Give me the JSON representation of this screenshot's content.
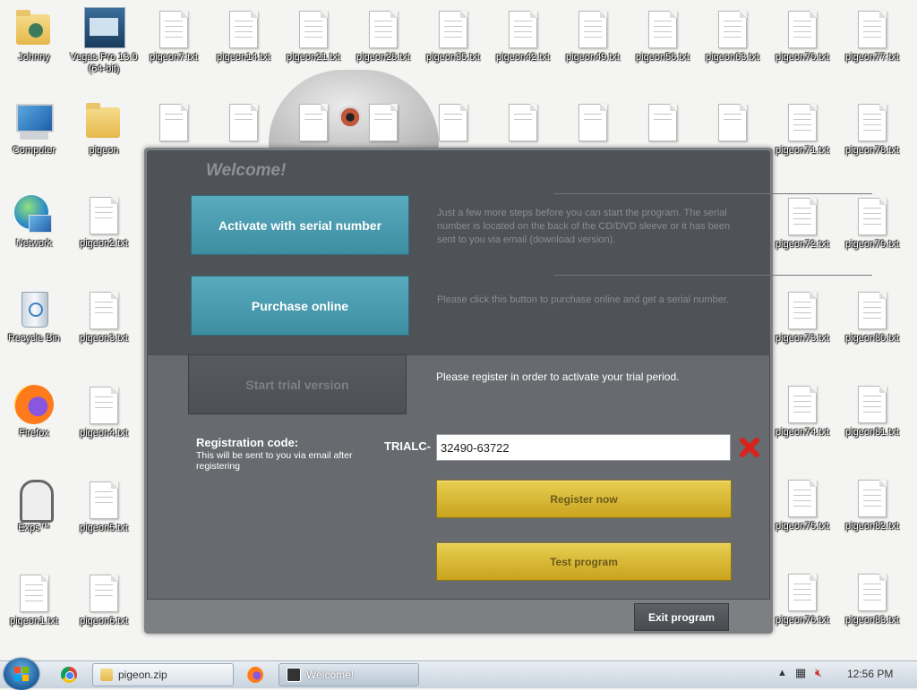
{
  "desktop": {
    "col1": [
      {
        "label": "Johnny",
        "icon": "user-folder-icon"
      },
      {
        "label": "Computer",
        "icon": "computer-icon"
      },
      {
        "label": "Network",
        "icon": "network-icon"
      },
      {
        "label": "Recycle Bin",
        "icon": "recycle-bin-icon"
      },
      {
        "label": "Firefox",
        "icon": "firefox-icon"
      },
      {
        "label": "Exps™",
        "icon": "app-icon"
      },
      {
        "label": "pigeon1.txt",
        "icon": "text-file-icon"
      }
    ],
    "col2": [
      {
        "label": "Vegas Pro 13.0 (64-bit)",
        "icon": "vegas-pro-icon"
      },
      {
        "label": "pigeon",
        "icon": "folder-icon"
      },
      {
        "label": "pigeon2.txt",
        "icon": "text-file-icon"
      },
      {
        "label": "pigeon3.txt",
        "icon": "text-file-icon"
      },
      {
        "label": "pigeon4.txt",
        "icon": "text-file-icon"
      },
      {
        "label": "pigeon5.txt",
        "icon": "text-file-icon"
      },
      {
        "label": "pigeon6.txt",
        "icon": "text-file-icon"
      }
    ],
    "row1_files": [
      "pigeon7.txt",
      "pigeon14.txt",
      "pigeon21.txt",
      "pigeon28.txt",
      "pigeon35.txt",
      "pigeon42.txt",
      "pigeon49.txt",
      "pigeon56.txt",
      "pigeon63.txt",
      "pigeon70.txt",
      "pigeon77.txt"
    ],
    "right_col1": [
      "pigeon71.txt",
      "pigeon72.txt",
      "pigeon73.txt",
      "pigeon74.txt",
      "pigeon75.txt",
      "pigeon76.txt"
    ],
    "right_col2": [
      "pigeon78.txt",
      "pigeon79.txt",
      "pigeon80.txt",
      "pigeon81.txt",
      "pigeon82.txt",
      "pigeon83.txt"
    ]
  },
  "dialog": {
    "title": "Welcome!",
    "activate_label": "Activate with serial number",
    "activate_desc": "Just a few more steps before you can start the program. The serial number is located on the back of the CD/DVD sleeve or it has been sent to you via email (download version).",
    "purchase_label": "Purchase online",
    "purchase_desc": "Please click this button to purchase online and get a serial number.",
    "trial_label": "Start trial version",
    "trial_desc": "Please register in order to activate your trial period.",
    "reg_title": "Registration code:",
    "reg_sub": "This will be sent to you via email after registering",
    "reg_prefix": "TRIALC-",
    "reg_value": "32490-63722",
    "register_label": "Register now",
    "test_label": "Test program",
    "exit_label": "Exit program"
  },
  "taskbar": {
    "tasks": [
      {
        "label": "pigeon.zip",
        "icon": "folder-icon",
        "active": false
      },
      {
        "label": "Welcome!",
        "icon": "lock-icon",
        "active": true
      }
    ],
    "clock": "12:56 PM"
  },
  "colors": {
    "accent_teal": "#4a9cb0",
    "gold": "#d9b935",
    "dialog_dark": "#4f5256",
    "dialog_mid": "#676a6e"
  }
}
